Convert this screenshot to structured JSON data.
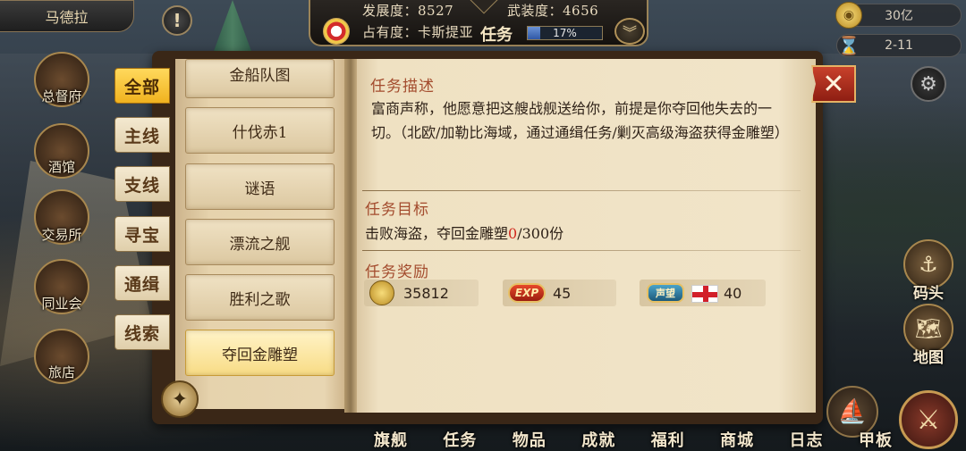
{
  "top": {
    "city": "马德拉",
    "dev_text": "发展度：8527",
    "arm_text": "武装度：4656",
    "occ_text": "占有度：卡斯提亚",
    "task_label": "任务",
    "progress_text": "17%",
    "progress_value": 17,
    "gold": "30亿",
    "time": "2-11"
  },
  "left_buildings": [
    {
      "label": "总督府"
    },
    {
      "label": "酒馆"
    },
    {
      "label": "交易所"
    },
    {
      "label": "同业会"
    },
    {
      "label": "旅店"
    }
  ],
  "categories": [
    "全部",
    "主线",
    "支线",
    "寻宝",
    "通缉",
    "线索"
  ],
  "active_category": "全部",
  "quests": {
    "partial": "金船队图",
    "items": [
      "什伐赤1",
      "谜语",
      "漂流之舰",
      "胜利之歌",
      "夺回金雕塑"
    ],
    "selected": "夺回金雕塑"
  },
  "detail": {
    "desc_title": "任务描述",
    "description": "富商声称，他愿意把这艘战舰送给你，前提是你夺回他失去的一切。（北欧/加勒比海域，通过通缉任务/剿灭高级海盗获得金雕塑）",
    "goal_title": "任务目标",
    "goal_prefix": "击败海盗，夺回金雕塑",
    "goal_current": "0",
    "goal_suffix": "/300份",
    "reward_title": "任务奖励",
    "rewards": {
      "gold": "35812",
      "exp_badge": "EXP",
      "exp": "45",
      "rep_badge": "声望",
      "rep": "40"
    }
  },
  "side_buttons": {
    "dock": "码头",
    "map": "地图"
  },
  "bottom_nav": [
    "旗舰",
    "任务",
    "物品",
    "成就",
    "福利",
    "商城",
    "日志",
    "甲板"
  ],
  "icons": {
    "alert": "alert-icon",
    "chevron": "chevron-down-icon",
    "close": "close-icon",
    "settings": "gear-icon",
    "compass": "compass-icon"
  },
  "colors": {
    "active_tab": "#f0b21f",
    "section_title": "#a34b2d",
    "goal_progress": "#d22a1f"
  }
}
